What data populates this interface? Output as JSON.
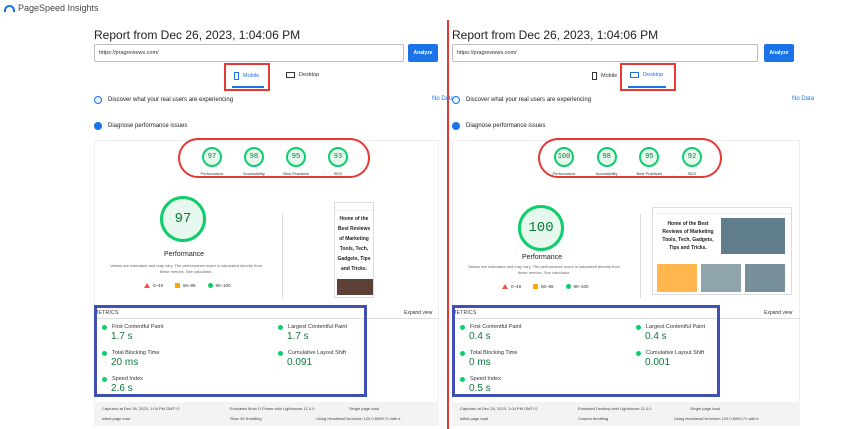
{
  "app": {
    "brand": "PageSpeed Insights"
  },
  "left": {
    "report_title": "Report from Dec 26, 2023, 1:04:06 PM",
    "url": "https://pragreviews.com/",
    "analyze": "Analyze",
    "tab_mobile": "Mobile",
    "tab_desktop": "Desktop",
    "discover": "Discover what your real users are experiencing",
    "no_data": "No Data",
    "diagnose": "Diagnose performance issues",
    "scores": [
      {
        "value": "97",
        "label": "Performance"
      },
      {
        "value": "98",
        "label": "Accessibility"
      },
      {
        "value": "95",
        "label": "Best Practices"
      },
      {
        "value": "93",
        "label": "SEO"
      }
    ],
    "perf_score": "97",
    "perf_label": "Performance",
    "note": "Values are estimated and may vary. The performance score is calculated directly from these metrics. See calculator.",
    "legend": [
      "0–49",
      "50–89",
      "90–100"
    ],
    "preview_text": "Home of the Best Reviews of Marketing Tools, Tech, Gadgets, Tips and Tricks.",
    "metrics_label": "METRICS",
    "expand": "Expand view",
    "metrics": [
      {
        "name": "First Contentful Paint",
        "value": "1.7 s"
      },
      {
        "name": "Largest Contentful Paint",
        "value": "1.7 s"
      },
      {
        "name": "Total Blocking Time",
        "value": "20 ms"
      },
      {
        "name": "Cumulative Layout Shift",
        "value": "0.091"
      },
      {
        "name": "Speed Index",
        "value": "2.6 s"
      }
    ],
    "footer": {
      "captured": "Captured at Dec 26, 2023, 1:04 PM GMT+2",
      "emulated": "Emulated Moto G Power with Lighthouse 11.0.0",
      "single": "Single page load",
      "initial": "Initial page load",
      "throttle": "Slow 4G throttling",
      "using": "Using HeadlessChromium 120.0.6099.71 with lr"
    }
  },
  "right": {
    "report_title": "Report from Dec 26, 2023, 1:04:06 PM",
    "url": "https://pragreviews.com/",
    "analyze": "Analyze",
    "tab_mobile": "Mobile",
    "tab_desktop": "Desktop",
    "discover": "Discover what your real users are experiencing",
    "no_data": "No Data",
    "diagnose": "Diagnose performance issues",
    "scores": [
      {
        "value": "100",
        "label": "Performance"
      },
      {
        "value": "98",
        "label": "Accessibility"
      },
      {
        "value": "95",
        "label": "Best Practices"
      },
      {
        "value": "92",
        "label": "SEO"
      }
    ],
    "perf_score": "100",
    "perf_label": "Performance",
    "note": "Values are estimated and may vary. The performance score is calculated directly from these metrics. See calculator.",
    "legend": [
      "0–49",
      "50–89",
      "90–100"
    ],
    "preview_text": "Home of the Best Reviews of Marketing Tools, Tech, Gadgets, Tips and Tricks.",
    "metrics_label": "METRICS",
    "expand": "Expand view",
    "metrics": [
      {
        "name": "First Contentful Paint",
        "value": "0.4 s"
      },
      {
        "name": "Largest Contentful Paint",
        "value": "0.4 s"
      },
      {
        "name": "Total Blocking Time",
        "value": "0 ms"
      },
      {
        "name": "Cumulative Layout Shift",
        "value": "0.001"
      },
      {
        "name": "Speed Index",
        "value": "0.5 s"
      }
    ],
    "footer": {
      "captured": "Captured at Dec 26, 2023, 1:04 PM GMT+2",
      "emulated": "Emulated Desktop with Lighthouse 11.0.0",
      "single": "Single page load",
      "initial": "Initial page load",
      "throttle": "Custom throttling",
      "using": "Using HeadlessChromium 120.0.6099.71 with lr"
    }
  },
  "colors": {
    "good": "#0cce6b",
    "accent": "#1a73e8",
    "highlight_red": "#e53935",
    "highlight_blue": "#3f51b5"
  }
}
